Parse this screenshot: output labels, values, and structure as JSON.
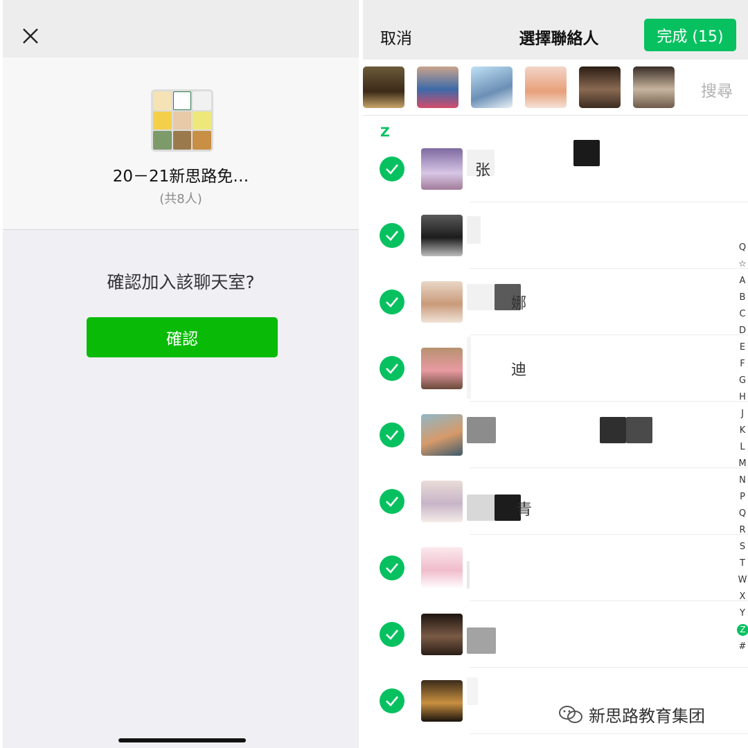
{
  "left": {
    "group_name": "20－21新思路免…",
    "member_count": "(共8人)",
    "confirm_question": "確認加入該聊天室?",
    "confirm_button": "確認",
    "close_icon": "close-icon"
  },
  "right": {
    "cancel_label": "取消",
    "title": "選擇聯絡人",
    "done_label": "完成 (15)",
    "search_placeholder": "搜尋",
    "section_letter": "Z",
    "contact_names": [
      "张",
      "",
      "娜",
      "迪",
      "",
      "青",
      "",
      "",
      ""
    ],
    "index_letters": [
      "Q",
      "☆",
      "A",
      "B",
      "C",
      "D",
      "E",
      "F",
      "G",
      "H",
      "J",
      "K",
      "L",
      "M",
      "N",
      "P",
      "Q",
      "R",
      "S",
      "T",
      "W",
      "X",
      "Y",
      "Z",
      "#"
    ],
    "active_index": "Z"
  },
  "watermark": "新思路教育集团",
  "colors": {
    "accent_green": "#07c160",
    "confirm_green": "#09bb07",
    "background_gray": "#efeff4"
  }
}
